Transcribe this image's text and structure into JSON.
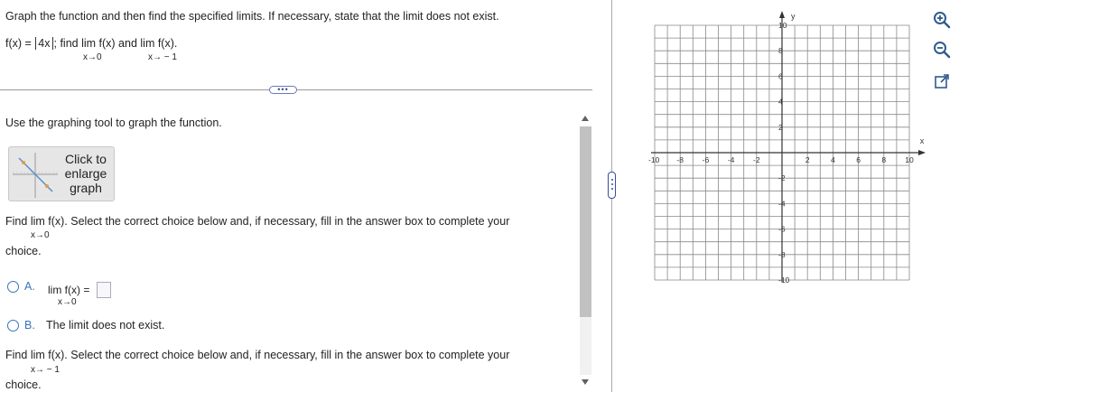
{
  "header": {
    "instructions": "Graph the function and then find the specified limits. If necessary, state that the limit does not exist.",
    "function_prefix": "f(x) = ",
    "function_abs": "4x",
    "function_find": "; find ",
    "lim1": "lim f(x)",
    "and": " and ",
    "lim2": "lim  f(x).",
    "sub1": "x→0",
    "sub2": "x→ − 1"
  },
  "more_button": "•••",
  "body": {
    "use_tool": "Use the graphing tool to graph the function.",
    "enlarge_label": "Click to\nenlarge\ngraph",
    "q1_find": "Find",
    "q1_lim": "lim f(x).",
    "q1_rest": " Select the correct choice below and, if necessary, fill in the answer box to complete your",
    "q1_sub": "x→0",
    "q1_choice": "choice.",
    "option_a_letter": "A.",
    "option_a_lim": "lim f(x) =",
    "option_a_sub": "x→0",
    "option_b_letter": "B.",
    "option_b_text": "The limit does not exist.",
    "q2_find": "Find",
    "q2_lim": "lim  f(x).",
    "q2_rest": " Select the correct choice below and, if necessary, fill in the answer box to complete your",
    "q2_sub": "x→ − 1",
    "q2_choice": "choice."
  },
  "graph": {
    "x_axis_label": "x",
    "y_axis_label": "y",
    "x_ticks": [
      "-10",
      "-8",
      "-6",
      "-4",
      "-2",
      "2",
      "4",
      "6",
      "8",
      "10"
    ],
    "y_ticks": [
      "10",
      "8",
      "6",
      "4",
      "2",
      "-2",
      "-4",
      "-6",
      "-8",
      "-10"
    ],
    "xlim": [
      -10,
      10
    ],
    "ylim": [
      -10,
      10
    ],
    "grid": true
  },
  "tools": {
    "zoom_in": "zoom-in-icon",
    "zoom_out": "zoom-out-icon",
    "popout": "popout-icon"
  },
  "colors": {
    "accent": "#3b73b9",
    "grid": "#888888",
    "button_bg": "#e6e6e6"
  }
}
